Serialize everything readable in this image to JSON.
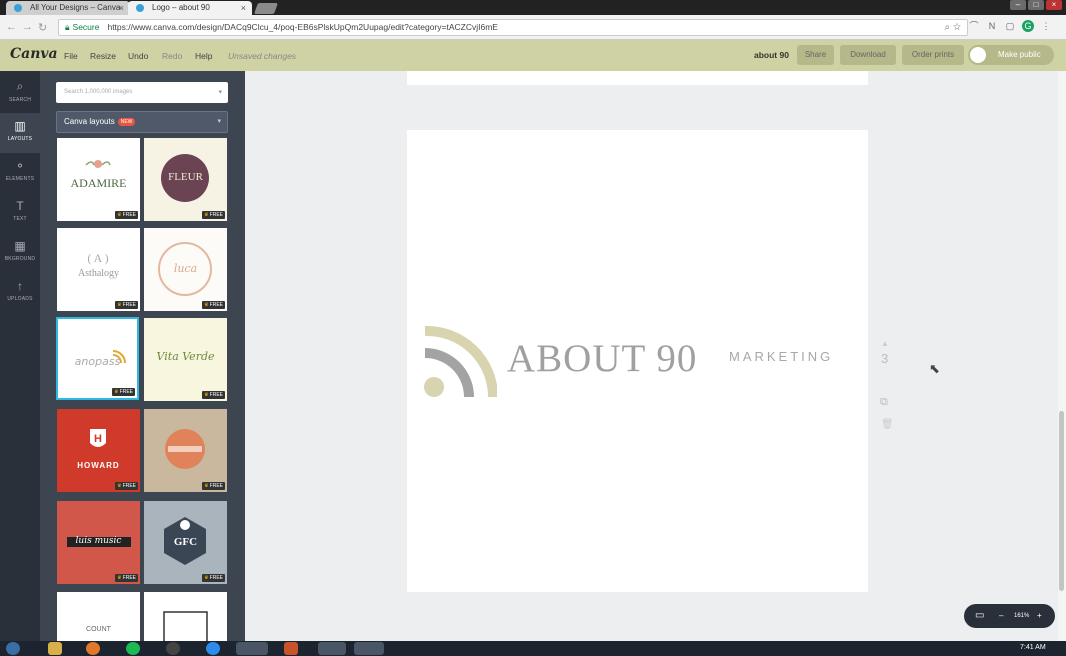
{
  "browser": {
    "tabs": [
      {
        "label": "All Your Designs – Canva"
      },
      {
        "label": "Logo – about 90"
      }
    ],
    "security_label": "Secure",
    "url": "https://www.canva.com/design/DACq9Clcu_4/poq-EB6sPlskUpQm2Uupag/edit?category=tACZCvjI6mE"
  },
  "toolbar": {
    "logo": "Canva",
    "menu": [
      "File",
      "Resize",
      "Undo",
      "Redo",
      "Help"
    ],
    "status": "Unsaved changes",
    "doc_title": "about 90",
    "share": "Share",
    "download": "Download",
    "order_prints": "Order prints",
    "make_public": "Make public"
  },
  "rail": [
    {
      "icon": "search-icon",
      "label": "SEARCH"
    },
    {
      "icon": "layouts-icon",
      "label": "LAYOUTS"
    },
    {
      "icon": "elements-icon",
      "label": "ELEMENTS"
    },
    {
      "icon": "text-icon",
      "label": "TEXT"
    },
    {
      "icon": "background-icon",
      "label": "BKGROUND"
    },
    {
      "icon": "uploads-icon",
      "label": "UPLOADS"
    }
  ],
  "panel": {
    "search_placeholder": "Search 1,000,000 images",
    "layouts_label": "Canva layouts",
    "new_badge": "NEW",
    "free_label": "FREE",
    "thumbs": [
      {
        "text": "ADAMIRE",
        "bg": "#ffffff"
      },
      {
        "text": "FLEUR",
        "bg": "#f7f3e4"
      },
      {
        "text": "Asthalogy",
        "bg": "#ffffff"
      },
      {
        "text": "luca",
        "bg": "#fdfbf8"
      },
      {
        "text": "anopass",
        "bg": "#ffffff"
      },
      {
        "text": "Vita Verde",
        "bg": "#f8f6df"
      },
      {
        "text": "HOWARD",
        "bg": "#cf3a2a"
      },
      {
        "text": "",
        "bg": "#c9b89e"
      },
      {
        "text": "luis music",
        "bg": "#d1574b"
      },
      {
        "text": "GFC",
        "bg": "#aab4bc"
      },
      {
        "text": "COUNT",
        "bg": "#ffffff"
      },
      {
        "text": "",
        "bg": "#ffffff"
      }
    ]
  },
  "canvas": {
    "logo_main": "ABOUT 90",
    "logo_sub": "MARKETING",
    "page_number": "3"
  },
  "zoom": {
    "value": "161%",
    "minus": "–",
    "plus": "+"
  },
  "taskbar": {
    "clock": "7:41 AM"
  },
  "colors": {
    "accent": "#cfd2a3",
    "rail": "#293039",
    "panel": "#3c4550"
  }
}
